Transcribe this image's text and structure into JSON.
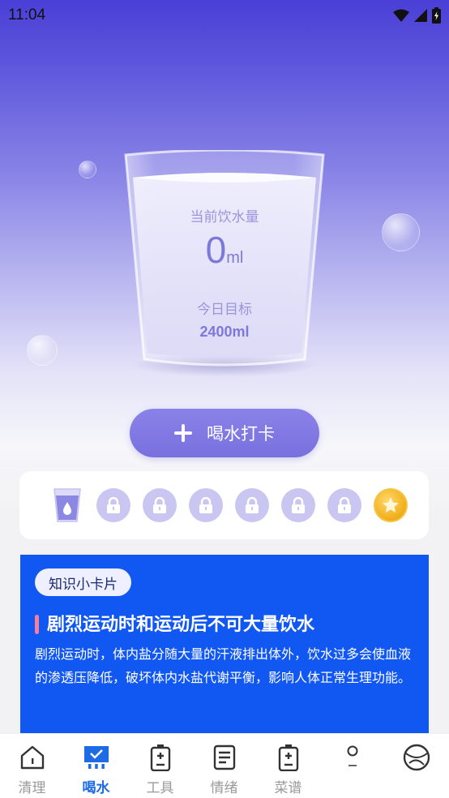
{
  "status_bar": {
    "time": "11:04"
  },
  "icons": [
    "wifi-icon",
    "signal-icon",
    "battery-icon",
    "plus-icon",
    "lock-icon",
    "coin-icon",
    "cup-icon"
  ],
  "glass": {
    "current_label": "当前饮水量",
    "current_value": "0",
    "current_unit": "ml",
    "goal_label": "今日目标",
    "goal_value": "2400ml"
  },
  "checkin_button": {
    "label": "喝水打卡"
  },
  "progress": {
    "filled": 1,
    "total_slots": 8
  },
  "knowledge": {
    "tag": "知识小卡片",
    "title": "剧烈运动时和运动后不可大量饮水",
    "body": "剧烈运动时，体内盐分随大量的汗液排出体外，饮水过多会使血液的渗透压降低，破坏体内水盐代谢平衡，影响人体正常生理功能。"
  },
  "nav": {
    "items": [
      {
        "label": "清理",
        "icon": "home-icon"
      },
      {
        "label": "喝水",
        "icon": "water-icon"
      },
      {
        "label": "工具",
        "icon": "battery-tool-icon"
      },
      {
        "label": "情绪",
        "icon": "document-icon"
      },
      {
        "label": "菜谱",
        "icon": "battery-recipe-icon"
      },
      {
        "label": "",
        "icon": "lightbulb-icon"
      },
      {
        "label": "",
        "icon": "ball-icon"
      }
    ],
    "active_index": 1
  },
  "colors": {
    "accent": "#7870de",
    "knowledge_bg": "#1157f2",
    "nav_active": "#1e6be6"
  }
}
